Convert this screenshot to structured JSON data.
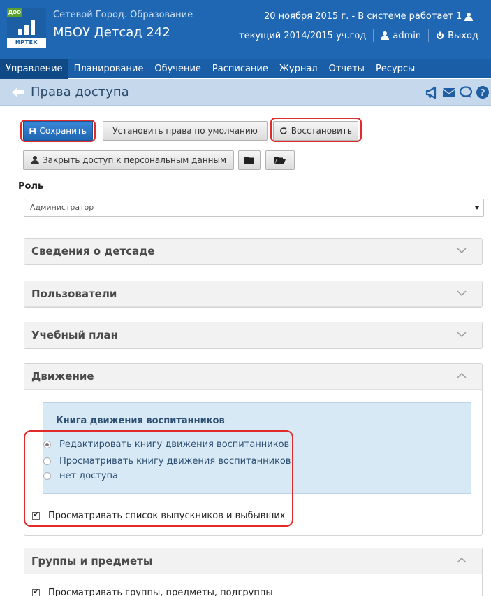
{
  "header": {
    "logo_top": "ДОО",
    "logo_bottom": "ИРТЕХ",
    "app_name": "Сетевой Город. Образование",
    "org_name": "МБОУ Детсад 242",
    "date_line": "20 ноября 2015 г. - В системе работает 1",
    "school_year": "текущий 2014/2015 уч.год",
    "user": "admin",
    "logout": "Выход"
  },
  "nav": {
    "items": [
      "Управление",
      "Планирование",
      "Обучение",
      "Расписание",
      "Журнал",
      "Отчеты",
      "Ресурсы"
    ]
  },
  "page": {
    "title": "Права доступа"
  },
  "toolbar": {
    "save": "Сохранить",
    "set_default": "Установить права по умолчанию",
    "restore": "Восстановить",
    "close_personal": "Закрыть доступ к персональным данным"
  },
  "role": {
    "label": "Роль",
    "value": "Администратор"
  },
  "sections": {
    "kindergarten": "Сведения о детсаде",
    "users": "Пользователи",
    "curriculum": "Учебный план",
    "movement": "Движение",
    "groups": "Группы и предметы"
  },
  "movement": {
    "book_title": "Книга движения воспитанников",
    "options": [
      "Редактировать книгу движения воспитанников",
      "Просматривать книгу движения воспитанников",
      "нет доступа"
    ],
    "selected_option": 0,
    "graduates_check": "Просматривать список выпускников и выбывших",
    "graduates_checked": true
  },
  "groups": {
    "view_check": "Просматривать группы, предметы, подгруппы",
    "view_checked": true
  },
  "colors": {
    "header": "#1f67b3",
    "nav": "#1a5ea7",
    "title_bar": "#c5d8ec",
    "highlight": "#e32a2a"
  }
}
